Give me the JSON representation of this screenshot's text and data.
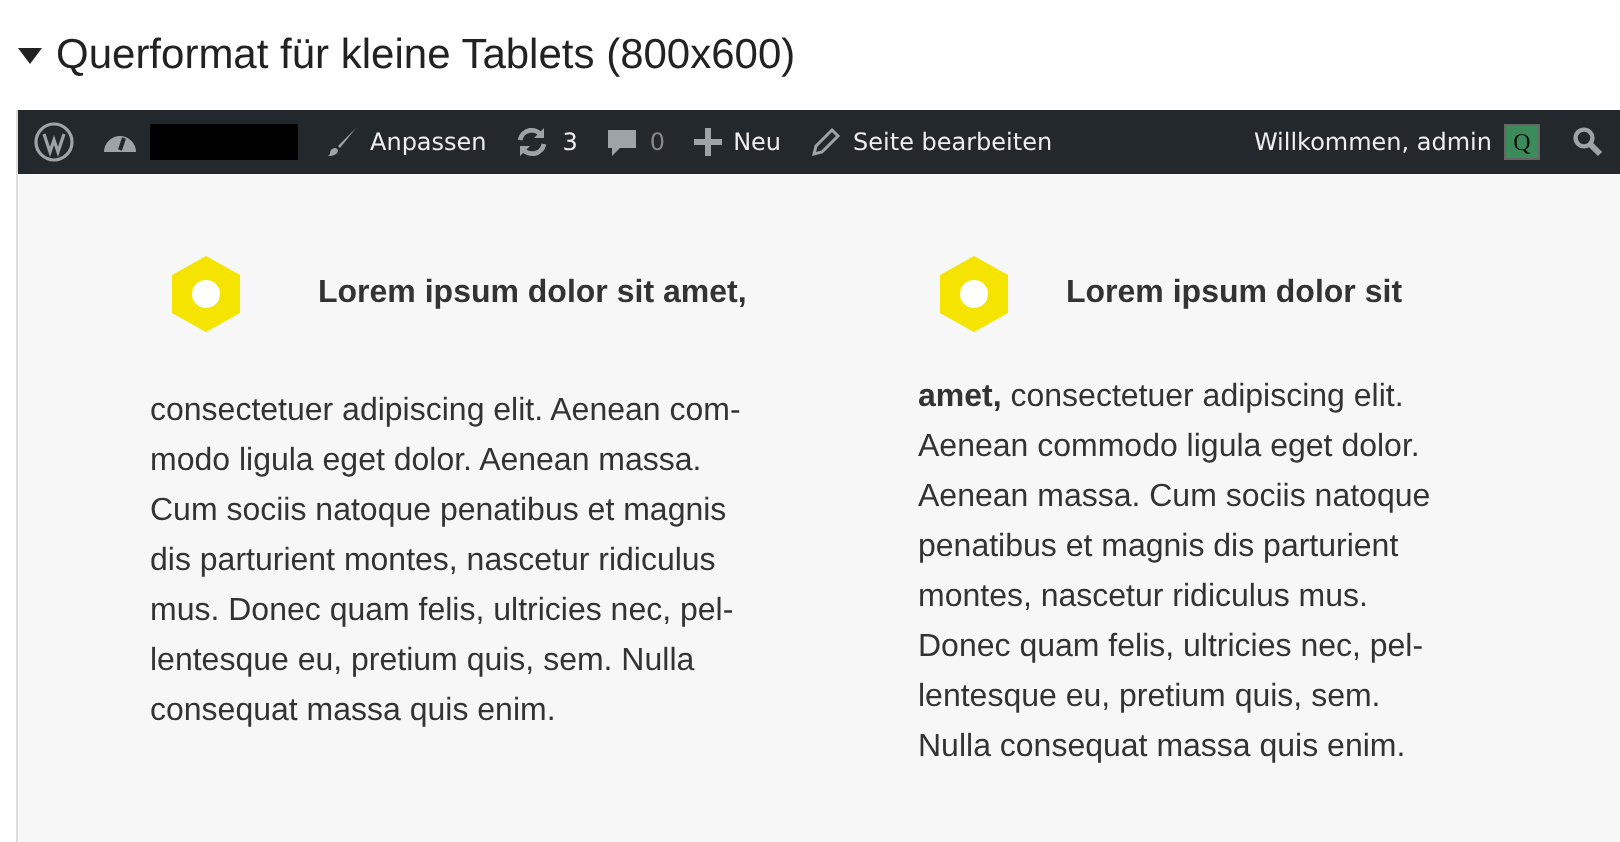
{
  "section": {
    "title": "Querformat für kleine Tablets (800x600)",
    "expanded": true
  },
  "admin_bar": {
    "items": [
      {
        "kind": "logo"
      },
      {
        "kind": "dashboard"
      },
      {
        "kind": "customize",
        "label": "Anpassen"
      },
      {
        "kind": "updates",
        "label": "3"
      },
      {
        "kind": "comments",
        "label": "0"
      },
      {
        "kind": "new",
        "label": "Neu"
      },
      {
        "kind": "edit",
        "label": "Seite bearbeiten"
      }
    ],
    "greeting": "Willkommen, admin",
    "avatar": "Q"
  },
  "columns": [
    {
      "heading": "Lorem ipsum dolor sit amet,",
      "lines": [
        "consectetuer adipiscing elit. Aenean com-",
        "modo ligula eget dolor. Aenean massa.",
        "Cum sociis natoque penatibus et magnis",
        "dis parturient montes, nascetur ridiculus",
        "mus. Donec quam felis, ultricies nec, pel-",
        "lentesque eu, pretium quis, sem. Nulla",
        "consequat massa quis enim."
      ]
    },
    {
      "heading": "Lorem ipsum dolor sit",
      "lines": [
        "**amet,** consectetuer adipiscing elit.",
        "Aenean commodo ligula eget dolor.",
        "Aenean massa. Cum sociis natoque",
        "penatibus et magnis dis parturient",
        "montes, nascetur ridiculus mus.",
        "Donec quam felis, ultricies nec, pel-",
        "lentesque eu, pretium quis, sem.",
        "Nulla consequat massa quis enim."
      ]
    }
  ]
}
